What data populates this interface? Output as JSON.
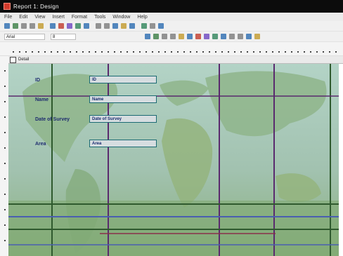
{
  "window": {
    "title": "Report 1: Design"
  },
  "menu": {
    "items": [
      "File",
      "Edit",
      "View",
      "Insert",
      "Format",
      "Tools",
      "Window",
      "Help"
    ]
  },
  "toolbar": {
    "font_select": "Arial",
    "size_select": "8",
    "tool_colors": [
      "#2b6cb0",
      "#3a7d44",
      "#7a7a7a",
      "#7a7a7a",
      "#c29a2c",
      "#2b6cb0",
      "#c0392b",
      "#6b46c1",
      "#2f855a",
      "#2b6cb0",
      "#7a7a7a",
      "#7a7a7a",
      "#2b6cb0",
      "#c29a2c",
      "#2b6cb0",
      "#2f855a",
      "#7a7a7a",
      "#2b6cb0"
    ]
  },
  "report": {
    "section_label": "Detail"
  },
  "fields": [
    {
      "label": "ID",
      "value": "ID"
    },
    {
      "label": "Name",
      "value": "Name"
    },
    {
      "label": "Date of Survey",
      "value": "Date of Survey"
    },
    {
      "label": "Area",
      "value": "Area"
    }
  ],
  "colors": {
    "grid_purple": "#5a2a6e",
    "grid_green": "#2f5a2e",
    "field_border": "#1b6a73",
    "map_ocean": "#a9c9be",
    "map_land": "#8fb58b"
  }
}
